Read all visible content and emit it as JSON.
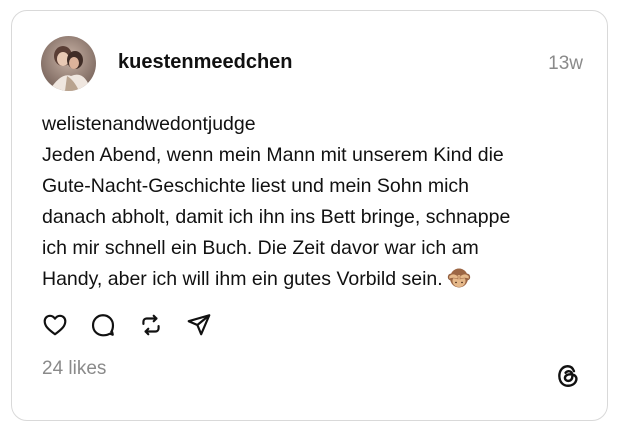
{
  "post": {
    "username": "kuestenmeedchen",
    "time": "13w",
    "tag": "welistenandwedontjudge",
    "text": "Jeden Abend, wenn mein Mann mit unserem Kind die\nGute-Nacht-Geschichte liest und mein Sohn mich\ndanach abholt, damit ich ihn ins Bett bringe, schnappe\nich mir schnell ein Buch. Die Zeit davor war ich am\nHandy, aber ich will ihm ein gutes Vorbild sein.",
    "emoji": "see-no-evil-monkey",
    "likes": "24 likes"
  },
  "actions": {
    "like_icon": "heart-icon",
    "comment_icon": "comment-icon",
    "repost_icon": "repost-icon",
    "share_icon": "share-icon"
  },
  "brand": {
    "icon": "threads-logo-icon"
  },
  "colors": {
    "text": "#111111",
    "muted": "#8a8a8a",
    "border": "#d9d9d9"
  }
}
